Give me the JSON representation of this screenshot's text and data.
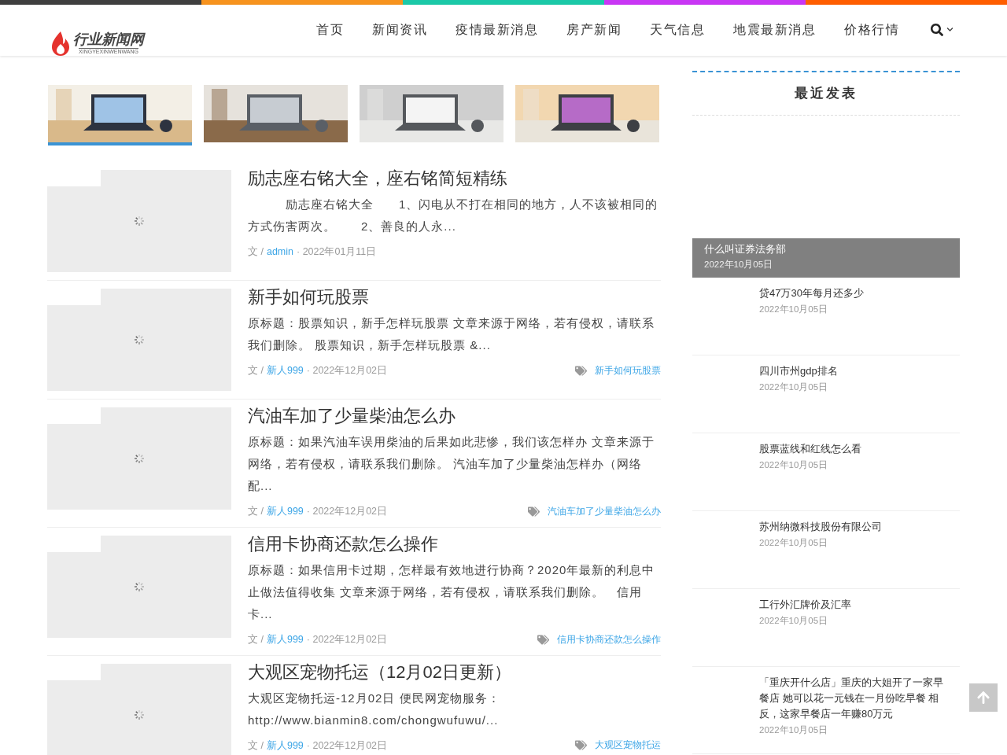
{
  "logo": {
    "name": "行业新闻网",
    "subtitle": "XINGYEXINWENWANG"
  },
  "top_stripes": [
    {
      "color": "#3f3f3f"
    },
    {
      "color": "#f7931e"
    },
    {
      "color": "#1bc9a8"
    },
    {
      "color": "#c936f5"
    },
    {
      "color": "#ff5e00"
    }
  ],
  "nav": [
    {
      "label": "首页"
    },
    {
      "label": "新闻资讯"
    },
    {
      "label": "疫情最新消息"
    },
    {
      "label": "房产新闻"
    },
    {
      "label": "天气信息"
    },
    {
      "label": "地震最新消息"
    },
    {
      "label": "价格行情"
    }
  ],
  "slider_thumbs": [
    {
      "kind": "picture",
      "selected": true
    },
    {
      "kind": "picture",
      "selected": false
    },
    {
      "kind": "picture",
      "selected": false
    },
    {
      "kind": "picture",
      "selected": false
    }
  ],
  "articles": [
    {
      "title": "励志座右铭大全，座右铭简短精练",
      "excerpt": "　　　励志座右铭大全　　1、闪电从不打在相同的地方，人不该被相同的方式伤害两次。　　2、善良的人永...",
      "by": "文 /",
      "author": "admin",
      "date": "· 2022年01月11日"
    },
    {
      "title": "新手如何玩股票",
      "excerpt": "原标题：股票知识，新手怎样玩股票 文章来源于网络，若有侵权，请联系我们删除。 股票知识，新手怎样玩股票 &...",
      "by": "文 /",
      "author": "新人999",
      "date": "· 2022年12月02日",
      "tag": "新手如何玩股票"
    },
    {
      "title": "汽油车加了少量柴油怎么办",
      "excerpt": "原标题：如果汽油车误用柴油的后果如此悲惨，我们该怎样办 文章来源于网络，若有侵权，请联系我们删除。 汽油车加了少量柴油怎样办（网络配...",
      "by": "文 /",
      "author": "新人999",
      "date": "· 2022年12月02日",
      "tag": "汽油车加了少量柴油怎么办"
    },
    {
      "title": "信用卡协商还款怎么操作",
      "excerpt": "原标题：如果信用卡过期，怎样最有效地进行协商？2020年最新的利息中止做法值得收集 文章来源于网络，若有侵权，请联系我们删除。　信用卡...",
      "by": "文 /",
      "author": "新人999",
      "date": "· 2022年12月02日",
      "tag": "信用卡协商还款怎么操作"
    },
    {
      "title": "大观区宠物托运（12月02日更新）",
      "excerpt": "大观区宠物托运-12月02日 便民网宠物服务：http://www.bianmin8.com/chongwufuwu/...",
      "by": "文 /",
      "author": "新人999",
      "date": "· 2022年12月02日",
      "tag": "大观区宠物托运"
    }
  ],
  "sidebar": {
    "title": "最近发表",
    "featured": {
      "title": "什么叫证券法务部",
      "date": "2022年10月05日"
    },
    "items": [
      {
        "title": "贷47万30年每月还多少",
        "date": "2022年10月05日"
      },
      {
        "title": "四川市州gdp排名",
        "date": "2022年10月05日"
      },
      {
        "title": "股票蓝线和红线怎么看",
        "date": "2022年10月05日"
      },
      {
        "title": "苏州纳微科技股份有限公司",
        "date": "2022年10月05日"
      },
      {
        "title": "工行外汇牌价及汇率",
        "date": "2022年10月05日"
      },
      {
        "title": "「重庆开什么店」重庆的大姐开了一家早餐店 她可以花一元钱在一月份吃早餐 相反，这家早餐店一年赚80万元",
        "date": "2022年10月05日"
      }
    ]
  }
}
